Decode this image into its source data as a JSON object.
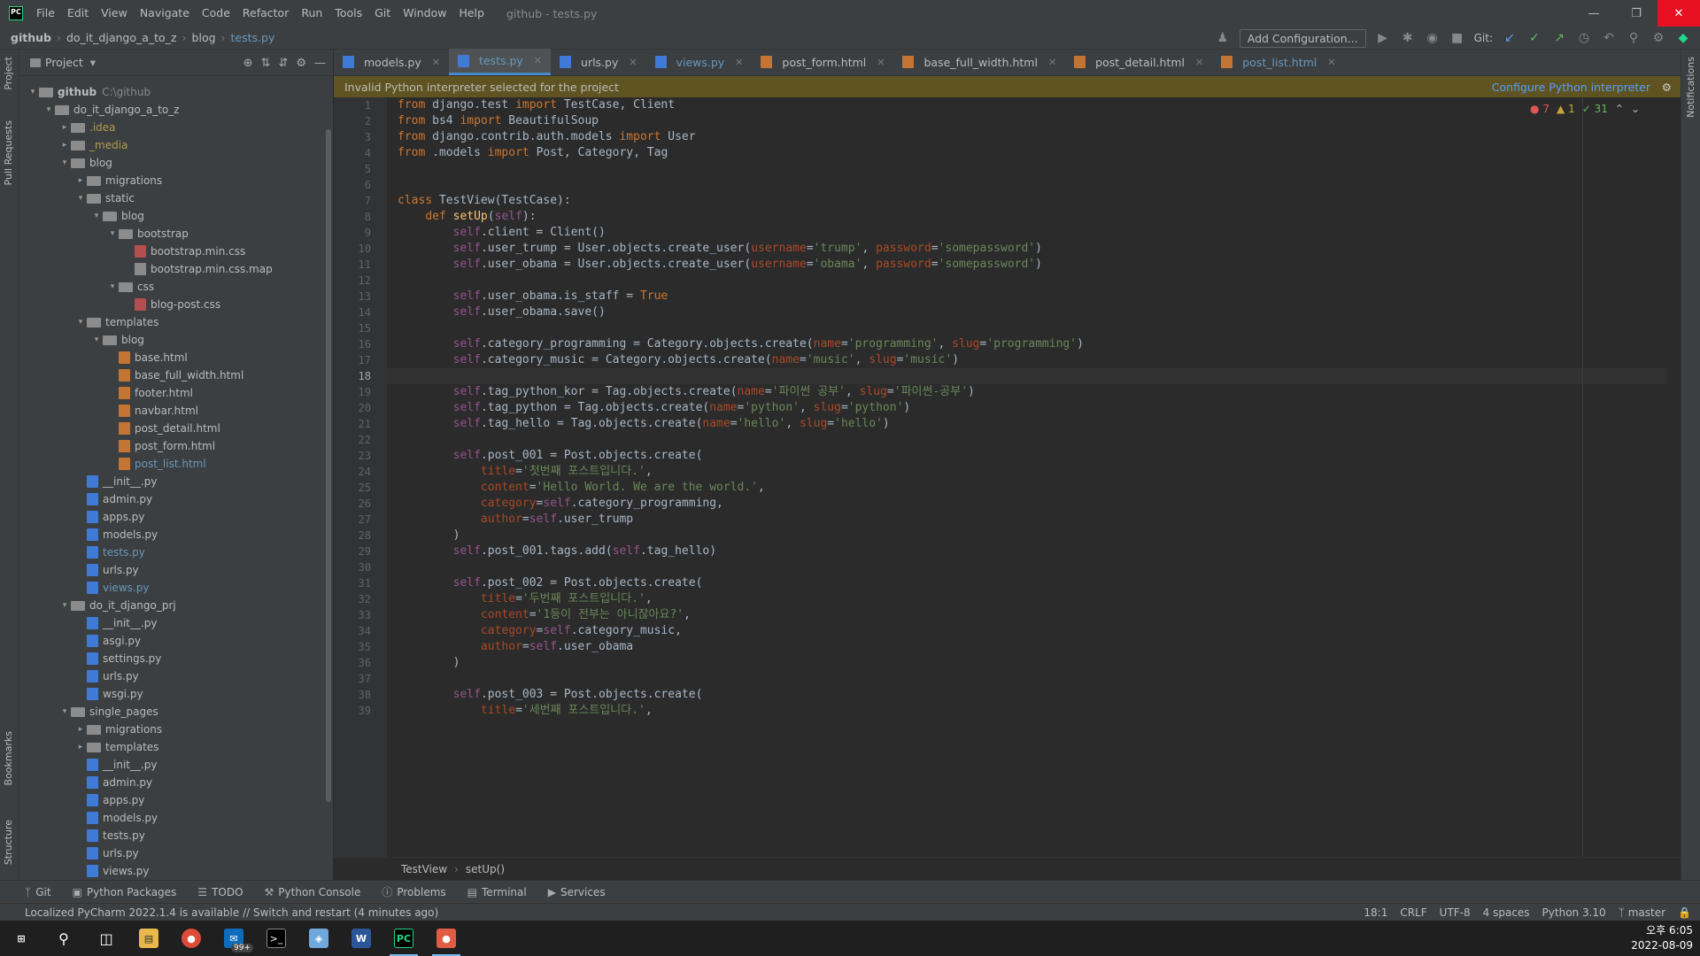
{
  "window": {
    "title": "github - tests.py"
  },
  "menu": [
    "File",
    "Edit",
    "View",
    "Navigate",
    "Code",
    "Refactor",
    "Run",
    "Tools",
    "Git",
    "Window",
    "Help"
  ],
  "breadcrumb": [
    "github",
    "do_it_django_a_to_z",
    "blog",
    "tests.py"
  ],
  "toolbar": {
    "add_config": "Add Configuration...",
    "git_label": "Git:"
  },
  "project": {
    "title": "Project",
    "nodes": [
      {
        "label": "github",
        "extra": "C:\\github",
        "depth": 0,
        "kind": "folder",
        "open": true
      },
      {
        "label": "do_it_django_a_to_z",
        "depth": 1,
        "kind": "folder",
        "open": true
      },
      {
        "label": ".idea",
        "depth": 2,
        "kind": "folder",
        "open": false,
        "color": "#b09c4c"
      },
      {
        "label": "_media",
        "depth": 2,
        "kind": "folder",
        "open": false,
        "color": "#b09c4c"
      },
      {
        "label": "blog",
        "depth": 2,
        "kind": "folder",
        "open": true
      },
      {
        "label": "migrations",
        "depth": 3,
        "kind": "folder",
        "open": false
      },
      {
        "label": "static",
        "depth": 3,
        "kind": "folder",
        "open": true
      },
      {
        "label": "blog",
        "depth": 4,
        "kind": "folder",
        "open": true
      },
      {
        "label": "bootstrap",
        "depth": 5,
        "kind": "folder",
        "open": true
      },
      {
        "label": "bootstrap.min.css",
        "depth": 6,
        "kind": "css"
      },
      {
        "label": "bootstrap.min.css.map",
        "depth": 6,
        "kind": "map"
      },
      {
        "label": "css",
        "depth": 5,
        "kind": "folder",
        "open": true
      },
      {
        "label": "blog-post.css",
        "depth": 6,
        "kind": "css"
      },
      {
        "label": "templates",
        "depth": 3,
        "kind": "folder",
        "open": true
      },
      {
        "label": "blog",
        "depth": 4,
        "kind": "folder",
        "open": true
      },
      {
        "label": "base.html",
        "depth": 5,
        "kind": "html"
      },
      {
        "label": "base_full_width.html",
        "depth": 5,
        "kind": "html"
      },
      {
        "label": "footer.html",
        "depth": 5,
        "kind": "html"
      },
      {
        "label": "navbar.html",
        "depth": 5,
        "kind": "html"
      },
      {
        "label": "post_detail.html",
        "depth": 5,
        "kind": "html"
      },
      {
        "label": "post_form.html",
        "depth": 5,
        "kind": "html"
      },
      {
        "label": "post_list.html",
        "depth": 5,
        "kind": "html",
        "color": "#6897bb"
      },
      {
        "label": "__init__.py",
        "depth": 3,
        "kind": "py"
      },
      {
        "label": "admin.py",
        "depth": 3,
        "kind": "py"
      },
      {
        "label": "apps.py",
        "depth": 3,
        "kind": "py"
      },
      {
        "label": "models.py",
        "depth": 3,
        "kind": "py"
      },
      {
        "label": "tests.py",
        "depth": 3,
        "kind": "py",
        "color": "#6897bb"
      },
      {
        "label": "urls.py",
        "depth": 3,
        "kind": "py"
      },
      {
        "label": "views.py",
        "depth": 3,
        "kind": "py",
        "color": "#6897bb"
      },
      {
        "label": "do_it_django_prj",
        "depth": 2,
        "kind": "folder",
        "open": true
      },
      {
        "label": "__init__.py",
        "depth": 3,
        "kind": "py"
      },
      {
        "label": "asgi.py",
        "depth": 3,
        "kind": "py"
      },
      {
        "label": "settings.py",
        "depth": 3,
        "kind": "py"
      },
      {
        "label": "urls.py",
        "depth": 3,
        "kind": "py"
      },
      {
        "label": "wsgi.py",
        "depth": 3,
        "kind": "py"
      },
      {
        "label": "single_pages",
        "depth": 2,
        "kind": "folder",
        "open": true
      },
      {
        "label": "migrations",
        "depth": 3,
        "kind": "folder",
        "open": false
      },
      {
        "label": "templates",
        "depth": 3,
        "kind": "folder",
        "open": false
      },
      {
        "label": "__init__.py",
        "depth": 3,
        "kind": "py"
      },
      {
        "label": "admin.py",
        "depth": 3,
        "kind": "py"
      },
      {
        "label": "apps.py",
        "depth": 3,
        "kind": "py"
      },
      {
        "label": "models.py",
        "depth": 3,
        "kind": "py"
      },
      {
        "label": "tests.py",
        "depth": 3,
        "kind": "py"
      },
      {
        "label": "urls.py",
        "depth": 3,
        "kind": "py"
      },
      {
        "label": "views.py",
        "depth": 3,
        "kind": "py"
      }
    ]
  },
  "tabs": [
    {
      "label": "models.py",
      "kind": "py"
    },
    {
      "label": "tests.py",
      "kind": "py",
      "active": true
    },
    {
      "label": "urls.py",
      "kind": "py"
    },
    {
      "label": "views.py",
      "kind": "py",
      "blue": true
    },
    {
      "label": "post_form.html",
      "kind": "html"
    },
    {
      "label": "base_full_width.html",
      "kind": "html"
    },
    {
      "label": "post_detail.html",
      "kind": "html"
    },
    {
      "label": "post_list.html",
      "kind": "html",
      "blue": true
    }
  ],
  "notice": {
    "text": "Invalid Python interpreter selected for the project",
    "action": "Configure Python interpreter"
  },
  "indicators": {
    "errors": "7",
    "warnings": "1",
    "ok": "31"
  },
  "code": [
    [
      [
        "kw",
        "from "
      ],
      [
        "cls",
        "django.test "
      ],
      [
        "kw",
        "import "
      ],
      [
        "cls",
        "TestCase, Client"
      ]
    ],
    [
      [
        "kw",
        "from "
      ],
      [
        "cls",
        "bs4 "
      ],
      [
        "kw",
        "import "
      ],
      [
        "cls",
        "BeautifulSoup"
      ]
    ],
    [
      [
        "kw",
        "from "
      ],
      [
        "cls",
        "django.contrib.auth.models "
      ],
      [
        "kw",
        "import "
      ],
      [
        "cls",
        "User"
      ]
    ],
    [
      [
        "kw",
        "from "
      ],
      [
        "cls",
        ".models "
      ],
      [
        "kw",
        "import "
      ],
      [
        "cls",
        "Post, Category, Tag"
      ]
    ],
    [],
    [],
    [
      [
        "kw",
        "class "
      ],
      [
        "cls",
        "TestView(TestCase):"
      ]
    ],
    [
      [
        "cls",
        "    "
      ],
      [
        "kw",
        "def "
      ],
      [
        "fn",
        "setUp"
      ],
      [
        "cls",
        "("
      ],
      [
        "self",
        "self"
      ],
      [
        "cls",
        "):"
      ]
    ],
    [
      [
        "cls",
        "        "
      ],
      [
        "self",
        "self"
      ],
      [
        "cls",
        ".client = Client()"
      ]
    ],
    [
      [
        "cls",
        "        "
      ],
      [
        "self",
        "self"
      ],
      [
        "cls",
        ".user_trump = User.objects.create_user("
      ],
      [
        "prm",
        "username"
      ],
      [
        "cls",
        "="
      ],
      [
        "str",
        "'trump'"
      ],
      [
        "cls",
        ", "
      ],
      [
        "prm",
        "password"
      ],
      [
        "cls",
        "="
      ],
      [
        "str",
        "'somepassword'"
      ],
      [
        "cls",
        ")"
      ]
    ],
    [
      [
        "cls",
        "        "
      ],
      [
        "self",
        "self"
      ],
      [
        "cls",
        ".user_obama = User.objects.create_user("
      ],
      [
        "prm",
        "username"
      ],
      [
        "cls",
        "="
      ],
      [
        "str",
        "'obama'"
      ],
      [
        "cls",
        ", "
      ],
      [
        "prm",
        "password"
      ],
      [
        "cls",
        "="
      ],
      [
        "str",
        "'somepassword'"
      ],
      [
        "cls",
        ")"
      ]
    ],
    [],
    [
      [
        "cls",
        "        "
      ],
      [
        "self",
        "self"
      ],
      [
        "cls",
        ".user_obama.is_staff = "
      ],
      [
        "kw",
        "True"
      ]
    ],
    [
      [
        "cls",
        "        "
      ],
      [
        "self",
        "self"
      ],
      [
        "cls",
        ".user_obama.save()"
      ]
    ],
    [],
    [
      [
        "cls",
        "        "
      ],
      [
        "self",
        "self"
      ],
      [
        "cls",
        ".category_programming = Category.objects.create("
      ],
      [
        "prm",
        "name"
      ],
      [
        "cls",
        "="
      ],
      [
        "str",
        "'programming'"
      ],
      [
        "cls",
        ", "
      ],
      [
        "prm",
        "slug"
      ],
      [
        "cls",
        "="
      ],
      [
        "str",
        "'programming'"
      ],
      [
        "cls",
        ")"
      ]
    ],
    [
      [
        "cls",
        "        "
      ],
      [
        "self",
        "self"
      ],
      [
        "cls",
        ".category_music = Category.objects.create("
      ],
      [
        "prm",
        "name"
      ],
      [
        "cls",
        "="
      ],
      [
        "str",
        "'music'"
      ],
      [
        "cls",
        ", "
      ],
      [
        "prm",
        "slug"
      ],
      [
        "cls",
        "="
      ],
      [
        "str",
        "'music'"
      ],
      [
        "cls",
        ")"
      ]
    ],
    [],
    [
      [
        "cls",
        "        "
      ],
      [
        "self",
        "self"
      ],
      [
        "cls",
        ".tag_python_kor = Tag.objects.create("
      ],
      [
        "prm",
        "name"
      ],
      [
        "cls",
        "="
      ],
      [
        "str",
        "'파이썬 공부'"
      ],
      [
        "cls",
        ", "
      ],
      [
        "prm",
        "slug"
      ],
      [
        "cls",
        "="
      ],
      [
        "str",
        "'파이썬-공부'"
      ],
      [
        "cls",
        ")"
      ]
    ],
    [
      [
        "cls",
        "        "
      ],
      [
        "self",
        "self"
      ],
      [
        "cls",
        ".tag_python = Tag.objects.create("
      ],
      [
        "prm",
        "name"
      ],
      [
        "cls",
        "="
      ],
      [
        "str",
        "'python'"
      ],
      [
        "cls",
        ", "
      ],
      [
        "prm",
        "slug"
      ],
      [
        "cls",
        "="
      ],
      [
        "str",
        "'python'"
      ],
      [
        "cls",
        ")"
      ]
    ],
    [
      [
        "cls",
        "        "
      ],
      [
        "self",
        "self"
      ],
      [
        "cls",
        ".tag_hello = Tag.objects.create("
      ],
      [
        "prm",
        "name"
      ],
      [
        "cls",
        "="
      ],
      [
        "str",
        "'hello'"
      ],
      [
        "cls",
        ", "
      ],
      [
        "prm",
        "slug"
      ],
      [
        "cls",
        "="
      ],
      [
        "str",
        "'hello'"
      ],
      [
        "cls",
        ")"
      ]
    ],
    [],
    [
      [
        "cls",
        "        "
      ],
      [
        "self",
        "self"
      ],
      [
        "cls",
        ".post_001 = Post.objects.create("
      ]
    ],
    [
      [
        "cls",
        "            "
      ],
      [
        "prm",
        "title"
      ],
      [
        "cls",
        "="
      ],
      [
        "str",
        "'첫번째 포스트입니다.'"
      ],
      [
        "cls",
        ","
      ]
    ],
    [
      [
        "cls",
        "            "
      ],
      [
        "prm",
        "content"
      ],
      [
        "cls",
        "="
      ],
      [
        "str",
        "'Hello World. We are the world.'"
      ],
      [
        "cls",
        ","
      ]
    ],
    [
      [
        "cls",
        "            "
      ],
      [
        "prm",
        "category"
      ],
      [
        "cls",
        "="
      ],
      [
        "self",
        "self"
      ],
      [
        "cls",
        ".category_programming,"
      ]
    ],
    [
      [
        "cls",
        "            "
      ],
      [
        "prm",
        "author"
      ],
      [
        "cls",
        "="
      ],
      [
        "self",
        "self"
      ],
      [
        "cls",
        ".user_trump"
      ]
    ],
    [
      [
        "cls",
        "        )"
      ]
    ],
    [
      [
        "cls",
        "        "
      ],
      [
        "self",
        "self"
      ],
      [
        "cls",
        ".post_001.tags.add("
      ],
      [
        "self",
        "self"
      ],
      [
        "cls",
        ".tag_hello)"
      ]
    ],
    [],
    [
      [
        "cls",
        "        "
      ],
      [
        "self",
        "self"
      ],
      [
        "cls",
        ".post_002 = Post.objects.create("
      ]
    ],
    [
      [
        "cls",
        "            "
      ],
      [
        "prm",
        "title"
      ],
      [
        "cls",
        "="
      ],
      [
        "str",
        "'두번째 포스트입니다.'"
      ],
      [
        "cls",
        ","
      ]
    ],
    [
      [
        "cls",
        "            "
      ],
      [
        "prm",
        "content"
      ],
      [
        "cls",
        "="
      ],
      [
        "str",
        "'1등이 전부는 아니잖아요?'"
      ],
      [
        "cls",
        ","
      ]
    ],
    [
      [
        "cls",
        "            "
      ],
      [
        "prm",
        "category"
      ],
      [
        "cls",
        "="
      ],
      [
        "self",
        "self"
      ],
      [
        "cls",
        ".category_music,"
      ]
    ],
    [
      [
        "cls",
        "            "
      ],
      [
        "prm",
        "author"
      ],
      [
        "cls",
        "="
      ],
      [
        "self",
        "self"
      ],
      [
        "cls",
        ".user_obama"
      ]
    ],
    [
      [
        "cls",
        "        )"
      ]
    ],
    [],
    [
      [
        "cls",
        "        "
      ],
      [
        "self",
        "self"
      ],
      [
        "cls",
        ".post_003 = Post.objects.create("
      ]
    ],
    [
      [
        "cls",
        "            "
      ],
      [
        "prm",
        "title"
      ],
      [
        "cls",
        "="
      ],
      [
        "str",
        "'세번째 포스트입니다.'"
      ],
      [
        "cls",
        ","
      ]
    ]
  ],
  "current_line": 18,
  "editor_breadcrumb": [
    "TestView",
    "setUp()"
  ],
  "toolwindows": [
    "Git",
    "Python Packages",
    "TODO",
    "Python Console",
    "Problems",
    "Terminal",
    "Services"
  ],
  "status": {
    "message": "Localized PyCharm 2022.1.4 is available // Switch and restart (4 minutes ago)",
    "position": "18:1",
    "eol": "CRLF",
    "encoding": "UTF-8",
    "indent": "4 spaces",
    "interpreter": "Python 3.10",
    "branch": "master"
  },
  "left_strip": [
    "Project",
    "Pull Requests",
    "Bookmarks",
    "Structure"
  ],
  "right_strip": [
    "Notifications"
  ],
  "clock": {
    "time": "오후 6:05",
    "date": "2022-08-09"
  },
  "taskbar_badge": "99+"
}
